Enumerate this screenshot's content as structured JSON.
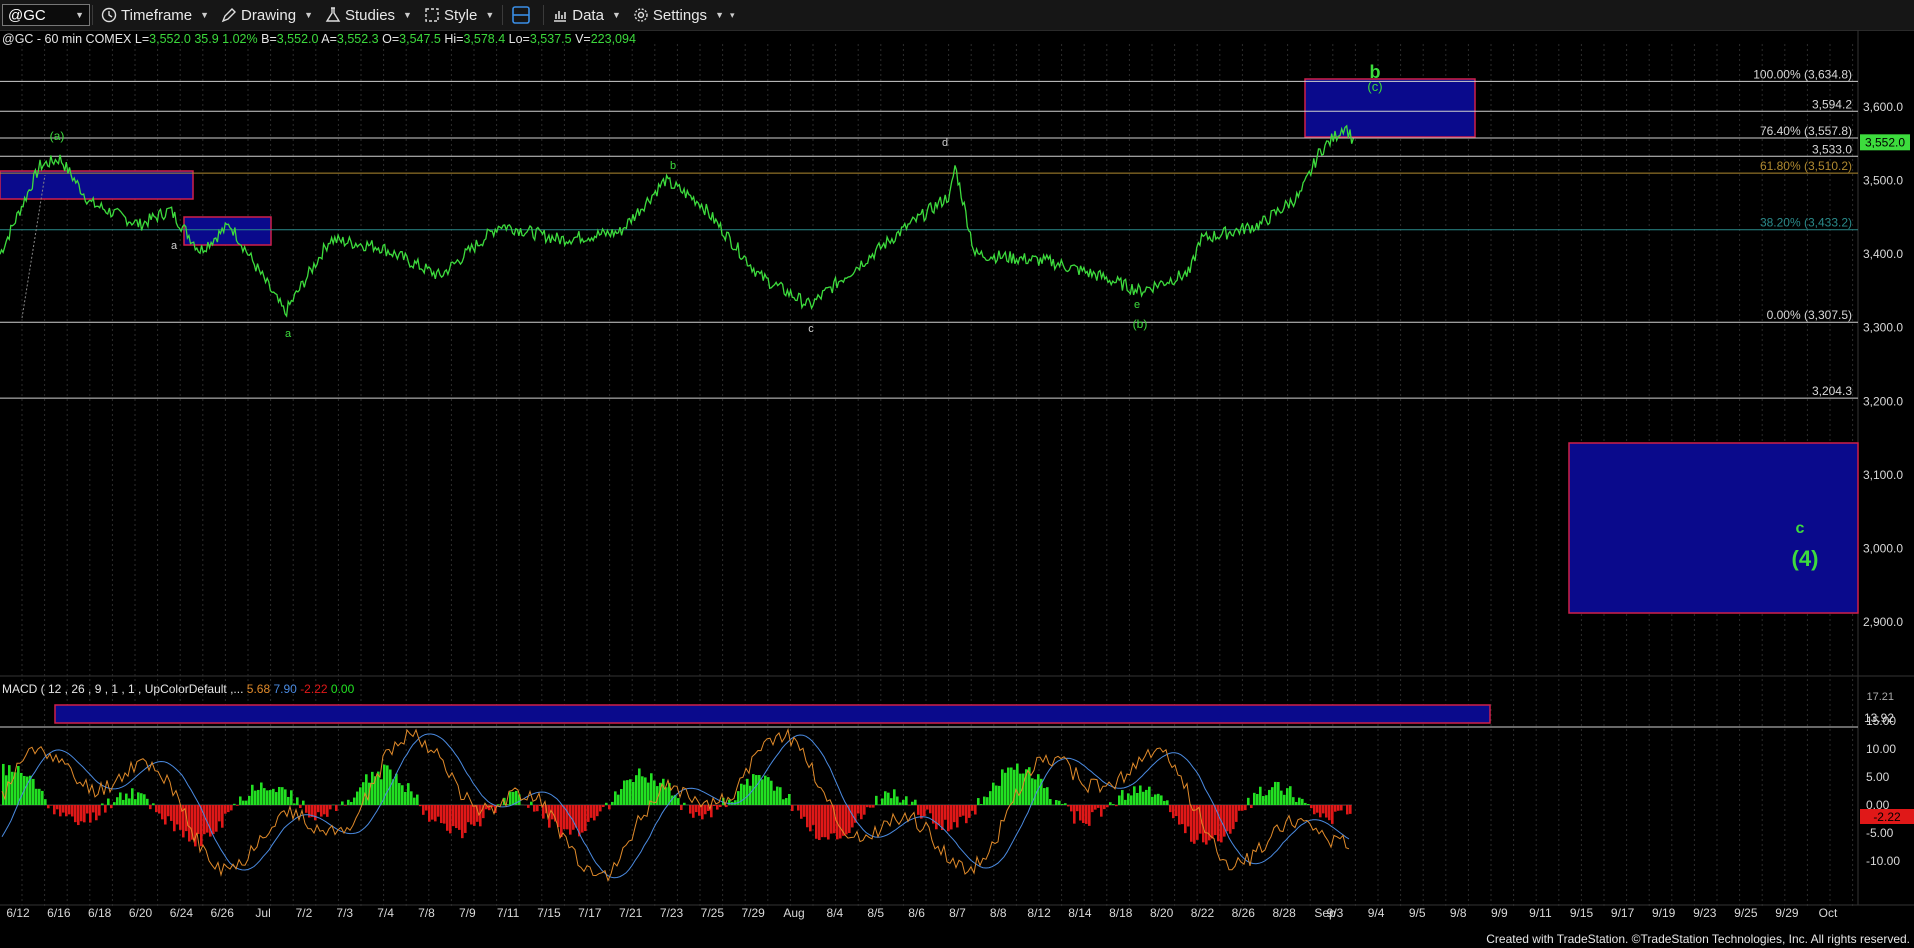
{
  "toolbar": {
    "symbol": "@GC",
    "timeframe": "Timeframe",
    "drawing": "Drawing",
    "studies": "Studies",
    "style": "Style",
    "data": "Data",
    "settings": "Settings"
  },
  "info": {
    "title": "@GC - 60 min COMEX",
    "last_label": "L=",
    "last": "3,552.0",
    "change": "35.9",
    "pct": "1.02%",
    "bid_label": "B=",
    "bid": "3,552.0",
    "ask_label": "A=",
    "ask": "3,552.3",
    "open_label": "O=",
    "open": "3,547.5",
    "hi_label": "Hi=",
    "hi": "3,578.4",
    "lo_label": "Lo=",
    "lo": "3,537.5",
    "vol_label": "V=",
    "vol": "223,094"
  },
  "macd": {
    "title": "MACD ( 12 , 26 , 9 , 1 , 1 , UpColorDefault ,...",
    "v1": "5.68",
    "v2": "7.90",
    "v3": "-2.22",
    "v4": "0.00"
  },
  "chart_data": {
    "type": "line",
    "price_axis": {
      "ticks": [
        "3,600.0",
        "3,500.0",
        "3,400.0",
        "3,300.0",
        "3,200.0",
        "3,100.0",
        "3,000.0",
        "2,900.0"
      ],
      "last_price": "3,552.0"
    },
    "macd_axis": {
      "ticks": [
        "15.00",
        "10.00",
        "5.00",
        "0.00",
        "-5.00",
        "-10.00"
      ],
      "labels": [
        "17.21",
        "13.92",
        "-2.22"
      ]
    },
    "x_labels": [
      "6/12",
      "6/16",
      "6/18",
      "6/20",
      "6/24",
      "6/26",
      "Jul",
      "7/2",
      "7/3",
      "7/4",
      "7/8",
      "7/9",
      "7/11",
      "7/15",
      "7/17",
      "7/21",
      "7/23",
      "7/25",
      "7/29",
      "Aug",
      "8/4",
      "8/5",
      "8/6",
      "8/7",
      "8/8",
      "8/12",
      "8/14",
      "8/18",
      "8/20",
      "8/22",
      "8/26",
      "8/28",
      "Sep",
      "9/3",
      "9/4",
      "9/5",
      "9/8",
      "9/9",
      "9/11",
      "9/15",
      "9/17",
      "9/19",
      "9/23",
      "9/25",
      "9/29",
      "Oct"
    ],
    "levels": [
      {
        "label": "100.00% (3,634.8)"
      },
      {
        "label": "3,594.2"
      },
      {
        "label": "76.40% (3,557.8)"
      },
      {
        "label": "3,533.0"
      },
      {
        "label": "61.80% (3,510.2)"
      },
      {
        "label": "38.20% (3,433.2)"
      },
      {
        "label": "0.00% (3,307.5)"
      },
      {
        "label": "3,204.3"
      }
    ],
    "wave_labels": [
      "(a)",
      "a",
      "a",
      "b",
      "c",
      "d",
      "e",
      "(b)",
      "(c)",
      "b",
      "c",
      "(4)"
    ],
    "colors": {
      "price": "#3ddc3d",
      "box_fill": "#0a0a8c",
      "box_border": "#d0204a",
      "macd_up": "#22e022",
      "macd_down": "#e01818",
      "macd_line": "#e08a2a",
      "signal_line": "#4a8ae0"
    }
  },
  "footer": "Created with TradeStation. ©TradeStation Technologies, Inc. All rights reserved."
}
